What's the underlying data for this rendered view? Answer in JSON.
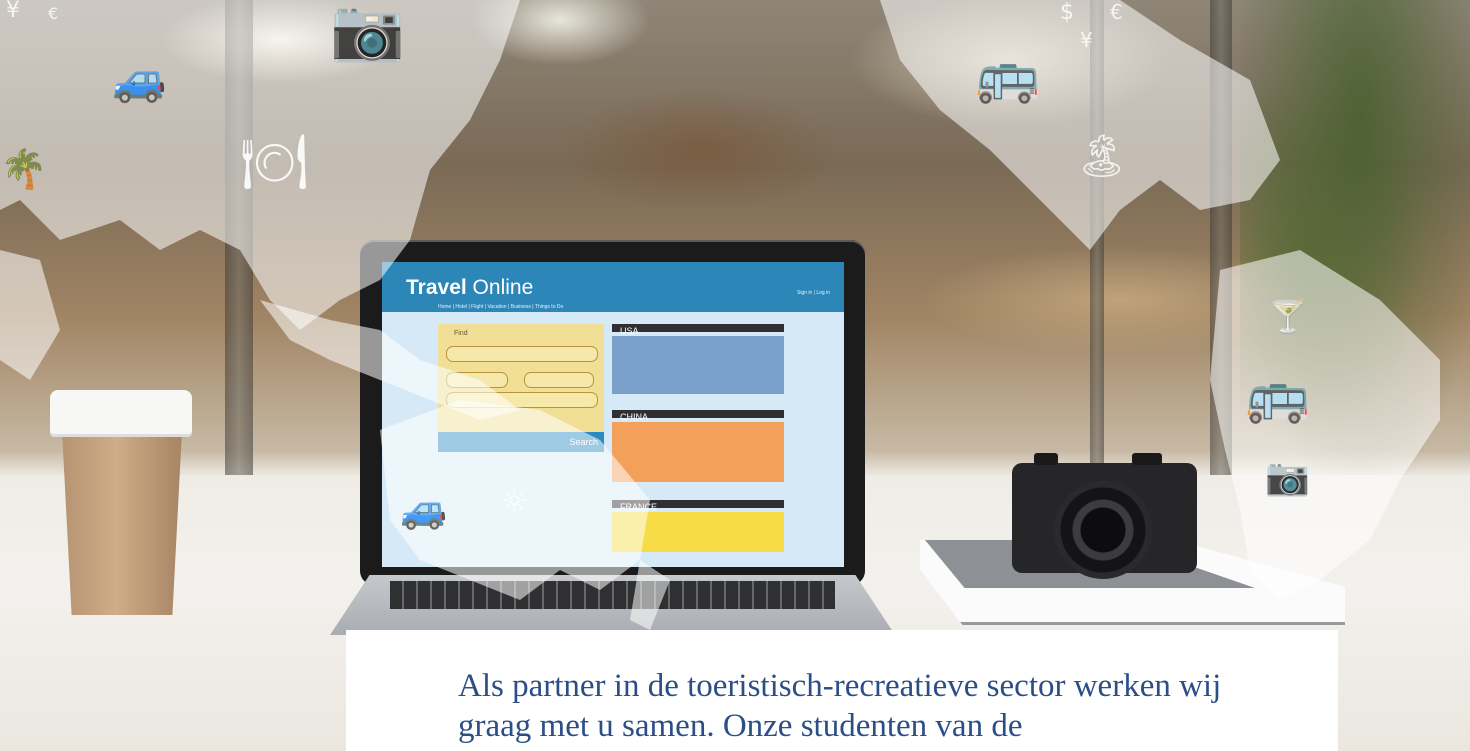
{
  "screen": {
    "logo_bold": "Travel",
    "logo_rest": " Online",
    "nav": "Home | Hotel | Flight | Vacation | Business | Things to Do",
    "signin": "Sign in | Log in",
    "find_title": "Find",
    "search_label": "Search",
    "destinations": [
      {
        "name": "USA",
        "color": "#7b9fcb"
      },
      {
        "name": "CHINA",
        "color": "#f3a05a"
      },
      {
        "name": "FRANCE",
        "color": "#f7dc48"
      }
    ]
  },
  "icons": {
    "currency": "€ $ ¥",
    "dollar": "$",
    "euro": "€",
    "yen": "¥"
  },
  "caption": "Als partner in de toeristisch-recreatieve sector werken wij graag met u samen. Onze studenten van de"
}
